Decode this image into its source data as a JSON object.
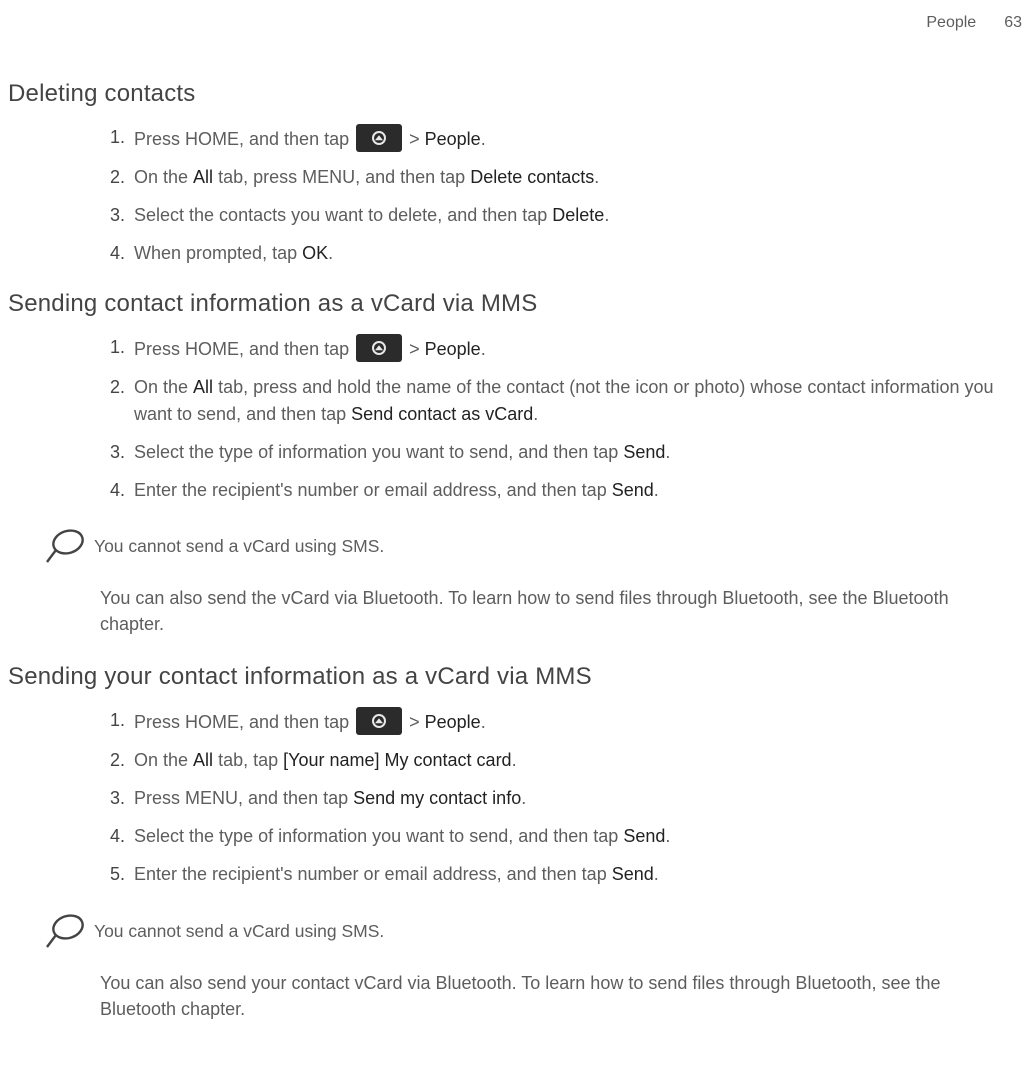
{
  "header": {
    "chapter": "People",
    "page": "63"
  },
  "s1": {
    "title": "Deleting contacts",
    "steps": {
      "n1": "1.",
      "t1a": "Press HOME, and then tap ",
      "t1b": " > ",
      "t1c": "People",
      "t1d": ".",
      "n2": "2.",
      "t2a": "On the ",
      "t2b": "All",
      "t2c": " tab, press MENU, and then tap ",
      "t2d": "Delete contacts",
      "t2e": ".",
      "n3": "3.",
      "t3a": "Select the contacts you want to delete, and then tap ",
      "t3b": "Delete",
      "t3c": ".",
      "n4": "4.",
      "t4a": "When prompted, tap ",
      "t4b": "OK",
      "t4c": "."
    }
  },
  "s2": {
    "title": "Sending contact information as a vCard via MMS",
    "steps": {
      "n1": "1.",
      "t1a": "Press HOME, and then tap ",
      "t1b": " > ",
      "t1c": "People",
      "t1d": ".",
      "n2": "2.",
      "t2a": "On the ",
      "t2b": "All",
      "t2c": " tab, press and hold the name of the contact (not the icon or photo) whose contact information you want to send, and then tap ",
      "t2d": "Send contact as vCard",
      "t2e": ".",
      "n3": "3.",
      "t3a": "Select the type of information you want to send, and then tap ",
      "t3b": "Send",
      "t3c": ".",
      "n4": "4.",
      "t4a": "Enter the recipient's number or email address, and then tap ",
      "t4b": "Send",
      "t4c": "."
    },
    "note": "You cannot send a vCard using SMS.",
    "para": "You can also send the vCard via Bluetooth. To learn how to send files through Bluetooth, see the Bluetooth chapter."
  },
  "s3": {
    "title": "Sending your contact information as a vCard via MMS",
    "steps": {
      "n1": "1.",
      "t1a": "Press HOME, and then tap ",
      "t1b": " > ",
      "t1c": "People",
      "t1d": ".",
      "n2": "2.",
      "t2a": "On the ",
      "t2b": "All",
      "t2c": " tab, tap ",
      "t2d": "[Your name] My contact card",
      "t2e": ".",
      "n3": "3.",
      "t3a": "Press MENU, and then tap ",
      "t3b": "Send my contact info",
      "t3c": ".",
      "n4": "4.",
      "t4a": "Select the type of information you want to send, and then tap ",
      "t4b": "Send",
      "t4c": ".",
      "n5": "5.",
      "t5a": "Enter the recipient's number or email address, and then tap ",
      "t5b": "Send",
      "t5c": "."
    },
    "note": "You cannot send a vCard using SMS.",
    "para": "You can also send your contact vCard via Bluetooth. To learn how to send files through Bluetooth, see the Bluetooth chapter."
  }
}
